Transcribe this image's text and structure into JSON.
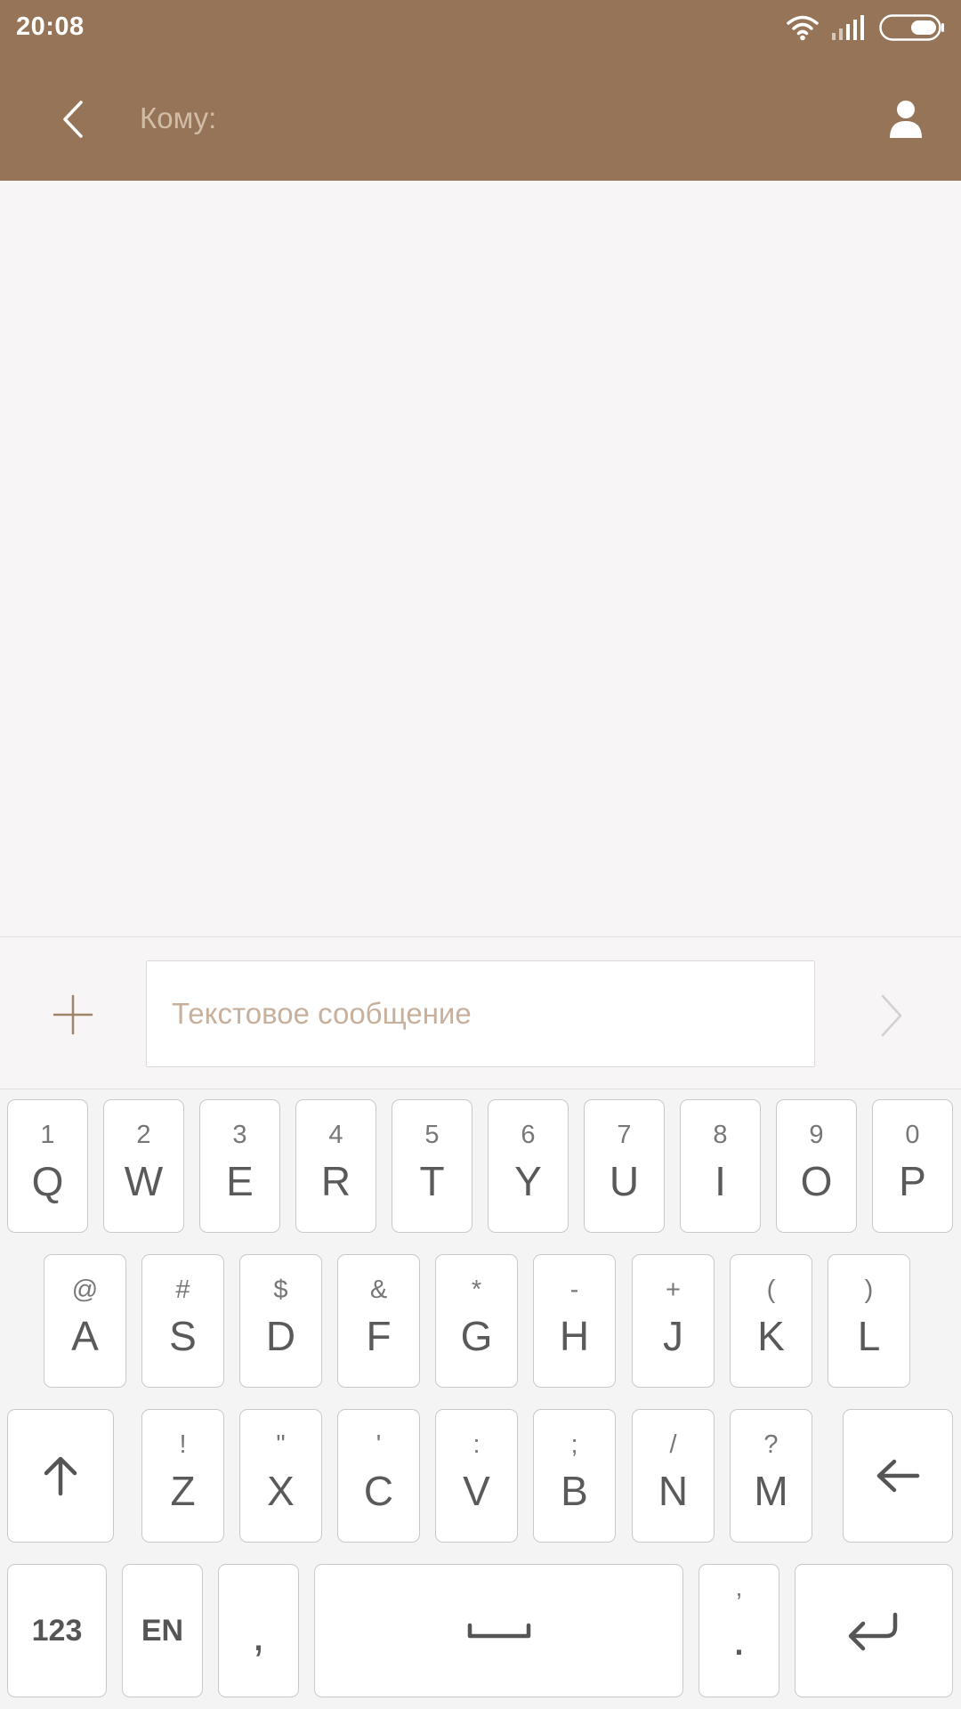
{
  "status_bar": {
    "time": "20:08"
  },
  "header": {
    "to_label": "Кому:"
  },
  "composer": {
    "placeholder": "Текстовое сообщение"
  },
  "keyboard": {
    "row1": [
      {
        "hint": "1",
        "key": "Q"
      },
      {
        "hint": "2",
        "key": "W"
      },
      {
        "hint": "3",
        "key": "E"
      },
      {
        "hint": "4",
        "key": "R"
      },
      {
        "hint": "5",
        "key": "T"
      },
      {
        "hint": "6",
        "key": "Y"
      },
      {
        "hint": "7",
        "key": "U"
      },
      {
        "hint": "8",
        "key": "I"
      },
      {
        "hint": "9",
        "key": "O"
      },
      {
        "hint": "0",
        "key": "P"
      }
    ],
    "row2": [
      {
        "hint": "@",
        "key": "A"
      },
      {
        "hint": "#",
        "key": "S"
      },
      {
        "hint": "$",
        "key": "D"
      },
      {
        "hint": "&",
        "key": "F"
      },
      {
        "hint": "*",
        "key": "G"
      },
      {
        "hint": "-",
        "key": "H"
      },
      {
        "hint": "+",
        "key": "J"
      },
      {
        "hint": "(",
        "key": "K"
      },
      {
        "hint": ")",
        "key": "L"
      }
    ],
    "row3": [
      {
        "hint": "!",
        "key": "Z"
      },
      {
        "hint": "\"",
        "key": "X"
      },
      {
        "hint": "'",
        "key": "C"
      },
      {
        "hint": ":",
        "key": "V"
      },
      {
        "hint": ";",
        "key": "B"
      },
      {
        "hint": "/",
        "key": "N"
      },
      {
        "hint": "?",
        "key": "M"
      }
    ],
    "numbers_label": "123",
    "language_label": "EN",
    "comma_key": ",",
    "period_hint": "’",
    "period_key": "."
  },
  "colors": {
    "app_bar": "#967457",
    "placeholder": "#c7b09c",
    "to_label": "#d1bca6"
  },
  "icons": {
    "back": "chevron-left-icon",
    "contact": "person-icon",
    "attach": "plus-icon",
    "send": "chevron-right-icon",
    "shift": "arrow-up-icon",
    "backspace": "arrow-left-icon",
    "space": "space-bar-icon",
    "enter": "return-icon"
  }
}
